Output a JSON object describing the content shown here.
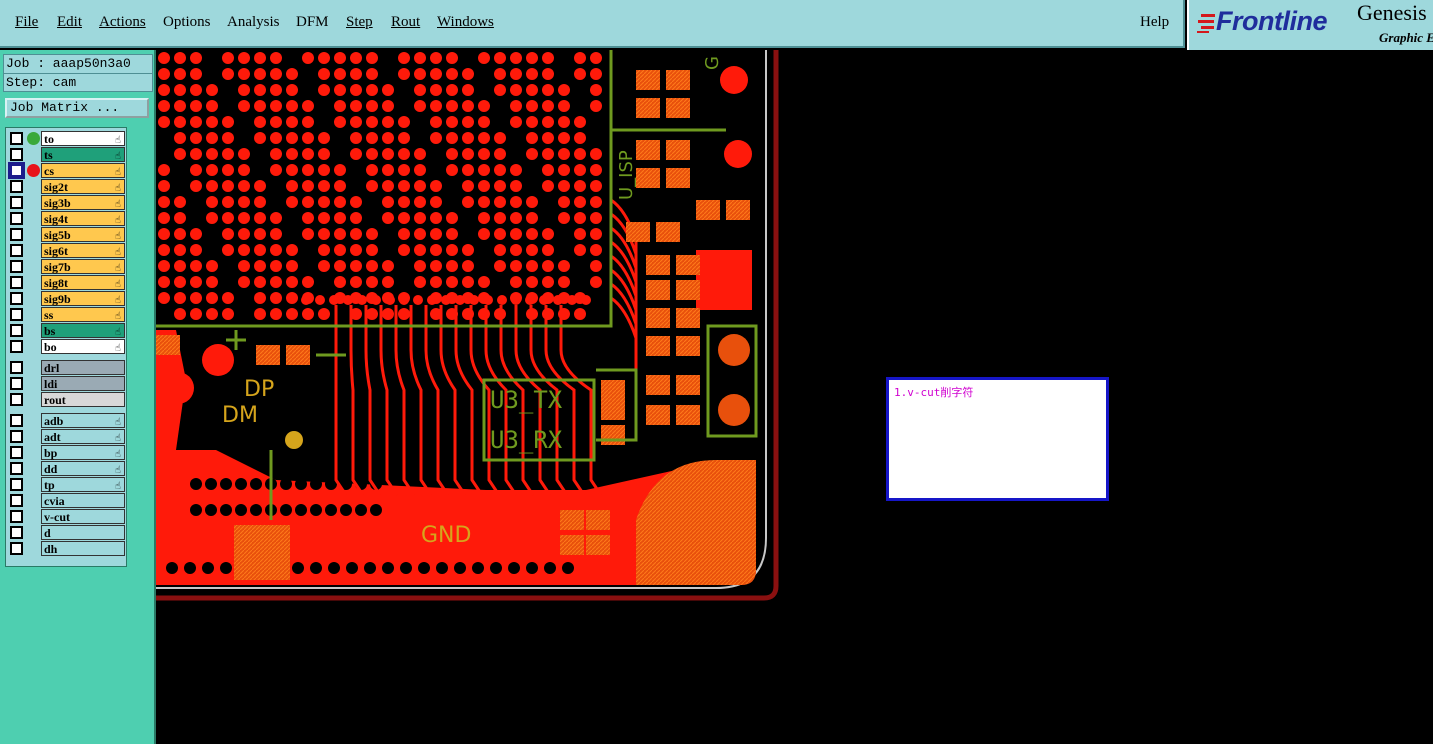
{
  "menu": {
    "file": "File",
    "edit": "Edit",
    "actions": "Actions",
    "options": "Options",
    "analysis": "Analysis",
    "dfm": "DFM",
    "step": "Step",
    "rout": "Rout",
    "windows": "Windows",
    "help": "Help"
  },
  "logo": {
    "brand": "Frontline",
    "product": "Genesis",
    "tagline": "Graphic E"
  },
  "job": {
    "job_line": "Job : aaap50n3a0",
    "step_line": "Step: cam",
    "matrix_button": "Job Matrix ..."
  },
  "layers": [
    {
      "name": "to",
      "color": "#ffffff",
      "dot": "#3aa93a",
      "selected": false
    },
    {
      "name": "ts",
      "color": "#1fa07a",
      "dot": "",
      "selected": false
    },
    {
      "name": "cs",
      "color": "#ffc84e",
      "dot": "#e8141a",
      "selected": true
    },
    {
      "name": "sig2t",
      "color": "#ffc84e",
      "dot": "",
      "selected": false
    },
    {
      "name": "sig3b",
      "color": "#ffc84e",
      "dot": "",
      "selected": false
    },
    {
      "name": "sig4t",
      "color": "#ffc84e",
      "dot": "",
      "selected": false
    },
    {
      "name": "sig5b",
      "color": "#ffc84e",
      "dot": "",
      "selected": false
    },
    {
      "name": "sig6t",
      "color": "#ffc84e",
      "dot": "",
      "selected": false
    },
    {
      "name": "sig7b",
      "color": "#ffc84e",
      "dot": "",
      "selected": false
    },
    {
      "name": "sig8t",
      "color": "#ffc84e",
      "dot": "",
      "selected": false
    },
    {
      "name": "sig9b",
      "color": "#ffc84e",
      "dot": "",
      "selected": false
    },
    {
      "name": "ss",
      "color": "#ffc84e",
      "dot": "",
      "selected": false
    },
    {
      "name": "bs",
      "color": "#1fa07a",
      "dot": "",
      "selected": false
    },
    {
      "name": "bo",
      "color": "#ffffff",
      "dot": "",
      "selected": false
    },
    {
      "name": "drl",
      "color": "#9aaab4",
      "dot": "",
      "selected": false
    },
    {
      "name": "ldi",
      "color": "#9aaab4",
      "dot": "",
      "selected": false
    },
    {
      "name": "rout",
      "color": "#d8d8d8",
      "dot": "",
      "selected": false
    },
    {
      "name": "adb",
      "color": "#9ed8dc",
      "dot": "",
      "selected": false
    },
    {
      "name": "adt",
      "color": "#9ed8dc",
      "dot": "",
      "selected": false
    },
    {
      "name": "bp",
      "color": "#9ed8dc",
      "dot": "",
      "selected": false
    },
    {
      "name": "dd",
      "color": "#9ed8dc",
      "dot": "",
      "selected": false
    },
    {
      "name": "tp",
      "color": "#9ed8dc",
      "dot": "",
      "selected": false
    },
    {
      "name": "cvia",
      "color": "#9ed8dc",
      "dot": "",
      "selected": false
    },
    {
      "name": "v-cut",
      "color": "#9ed8dc",
      "dot": "",
      "selected": false
    },
    {
      "name": "d",
      "color": "#9ed8dc",
      "dot": "",
      "selected": false
    },
    {
      "name": "dh",
      "color": "#9ed8dc",
      "dot": "",
      "selected": false
    }
  ],
  "pcb_labels": {
    "dp": "DP",
    "dm": "DM",
    "gnd": "GND",
    "u3tx": "U3_TX",
    "u3rx": "U3_RX",
    "isp": "U_ISP",
    "g": "G"
  },
  "note": {
    "text": "1.v-cut削字符"
  },
  "colors": {
    "copper": "#ff1a0a",
    "silkscreen": "#6f9a1f",
    "label": "#d6a51c",
    "outline": "#a01010",
    "menubar": "#9ed8dc",
    "panel": "#4ecfb0",
    "note_border": "#1616c8",
    "note_text": "#d000d0"
  }
}
